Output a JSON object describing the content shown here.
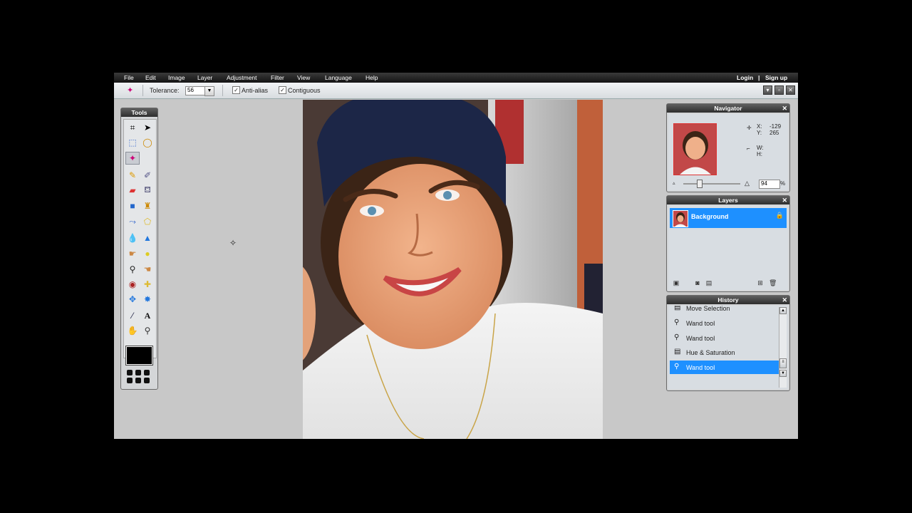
{
  "menubar": {
    "items": [
      "File",
      "Edit",
      "Image",
      "Layer",
      "Adjustment",
      "Filter",
      "View",
      "Language",
      "Help"
    ],
    "login": "Login",
    "separator": "|",
    "signup": "Sign up"
  },
  "options": {
    "tolerance_label": "Tolerance:",
    "tolerance_value": "56",
    "antialias_label": "Anti-alias",
    "antialias_checked": true,
    "contiguous_label": "Contiguous",
    "contiguous_checked": true,
    "tool_icon": "magic-wand-icon"
  },
  "tools": {
    "title": "Tools",
    "active_tool": "magic-wand-icon",
    "foreground_color": "#000000"
  },
  "navigator": {
    "title": "Navigator",
    "x_label": "X:",
    "x_value": "-129",
    "y_label": "Y:",
    "y_value": "265",
    "w_label": "W:",
    "h_label": "H:",
    "zoom_value": "94",
    "zoom_unit": "%"
  },
  "layers": {
    "title": "Layers",
    "items": [
      {
        "name": "Background",
        "locked": true,
        "selected": true
      }
    ]
  },
  "history": {
    "title": "History",
    "items": [
      {
        "label": "Move Selection",
        "icon": "move-selection-icon"
      },
      {
        "label": "Wand tool",
        "icon": "magic-wand-icon"
      },
      {
        "label": "Wand tool",
        "icon": "magic-wand-icon"
      },
      {
        "label": "Hue & Saturation",
        "icon": "adjustment-icon"
      },
      {
        "label": "Wand tool",
        "icon": "magic-wand-icon",
        "selected": true
      }
    ]
  },
  "colors": {
    "menubar": "#1c1c1c",
    "selection_blue": "#1e90ff",
    "workspace": "#c8c8c8"
  }
}
